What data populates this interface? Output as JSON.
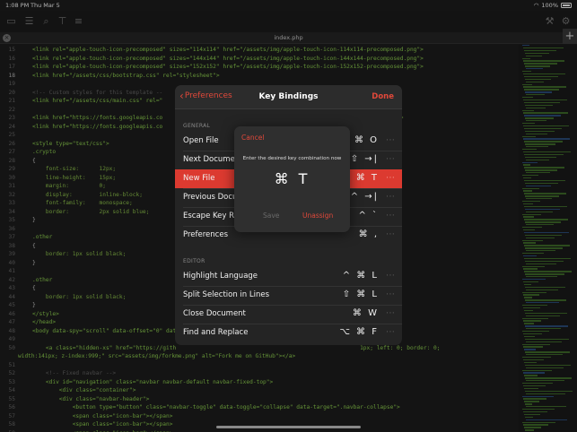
{
  "status_bar": {
    "time": "1:08 PM",
    "date": "Thu Mar 5",
    "battery": "100%"
  },
  "tab": {
    "title": "index.php",
    "add_label": "+"
  },
  "editor": {
    "lines": [
      {
        "n": "15",
        "text": "<link rel=\"apple-touch-icon-precomposed\" sizes=\"114x114\" href=\"/assets/img/apple-touch-icon-114x114-precomposed.png\">",
        "kind": "tag"
      },
      {
        "n": "16",
        "text": "<link rel=\"apple-touch-icon-precomposed\" sizes=\"144x144\" href=\"/assets/img/apple-touch-icon-144x144-precomposed.png\">",
        "kind": "tag"
      },
      {
        "n": "17",
        "text": "<link rel=\"apple-touch-icon-precomposed\" sizes=\"152x152\" href=\"/assets/img/apple-touch-icon-152x152-precomposed.png\">",
        "kind": "tag"
      },
      {
        "n": "18",
        "text": "<link href=\"/assets/css/bootstrap.css\" rel=\"stylesheet\">",
        "kind": "tag",
        "current": true
      },
      {
        "n": "19",
        "text": "",
        "kind": "tag"
      },
      {
        "n": "20",
        "text": "<!-- Custom styles for this template --",
        "kind": "comment"
      },
      {
        "n": "21",
        "text": "<link href=\"/assets/css/main.css\" rel=\"",
        "kind": "tag"
      },
      {
        "n": "22",
        "text": "",
        "kind": "tag"
      },
      {
        "n": "23",
        "text": "<link href=\"https://fonts.googleapis.co                                                     t' type='text/css'>",
        "kind": "tag"
      },
      {
        "n": "24",
        "text": "<link href=\"https://fonts.googleapis.co                                                     ss'>",
        "kind": "tag"
      },
      {
        "n": "25",
        "text": "",
        "kind": "tag"
      },
      {
        "n": "26",
        "text": "<style type=\"text/css\">",
        "kind": "tag"
      },
      {
        "n": "27",
        "text": ".crypto",
        "kind": "tag"
      },
      {
        "n": "28",
        "text": "{",
        "kind": "plain"
      },
      {
        "n": "29",
        "text": "    font-size:      12px;",
        "kind": "prop"
      },
      {
        "n": "30",
        "text": "    line-height:    15px;",
        "kind": "prop"
      },
      {
        "n": "31",
        "text": "    margin:         0;",
        "kind": "prop"
      },
      {
        "n": "32",
        "text": "    display:        inline-block;",
        "kind": "prop"
      },
      {
        "n": "33",
        "text": "    font-family:    monospace;",
        "kind": "prop"
      },
      {
        "n": "34",
        "text": "    border:         2px solid blue;",
        "kind": "prop"
      },
      {
        "n": "35",
        "text": "}",
        "kind": "plain"
      },
      {
        "n": "36",
        "text": "",
        "kind": "plain"
      },
      {
        "n": "37",
        "text": ".other",
        "kind": "tag"
      },
      {
        "n": "38",
        "text": "{",
        "kind": "plain"
      },
      {
        "n": "39",
        "text": "    border: 1px solid black;",
        "kind": "prop"
      },
      {
        "n": "40",
        "text": "}",
        "kind": "plain"
      },
      {
        "n": "41",
        "text": "",
        "kind": "plain"
      },
      {
        "n": "42",
        "text": ".other",
        "kind": "tag"
      },
      {
        "n": "43",
        "text": "{",
        "kind": "plain"
      },
      {
        "n": "44",
        "text": "    border: 1px solid black;",
        "kind": "prop"
      },
      {
        "n": "45",
        "text": "}",
        "kind": "plain"
      },
      {
        "n": "46",
        "text": "</style>",
        "kind": "tag"
      },
      {
        "n": "47",
        "text": "</head>",
        "kind": "tag"
      },
      {
        "n": "48",
        "text": "<body data-spy=\"scroll\" data-offset=\"0\" dat",
        "kind": "tag"
      },
      {
        "n": "49",
        "text": "",
        "kind": "plain"
      },
      {
        "n": "50",
        "text": "    <a class=\"hidden-xs\" href=\"https://gith                                                       1px; left: 0; border: 0;",
        "kind": "tag"
      },
      {
        "n": "",
        "text": "width:141px; z-index:999;\" src=\"assets/img/forkme.png\" alt=\"Fork me on GitHub\"></a>",
        "kind": "tag",
        "wrap": true
      },
      {
        "n": "51",
        "text": "",
        "kind": "plain"
      },
      {
        "n": "52",
        "text": "    <!-- Fixed navbar -->",
        "kind": "comment"
      },
      {
        "n": "53",
        "text": "    <div id=\"navigation\" class=\"navbar navbar-default navbar-fixed-top\">",
        "kind": "tag"
      },
      {
        "n": "54",
        "text": "        <div class=\"container\">",
        "kind": "tag"
      },
      {
        "n": "55",
        "text": "        <div class=\"navbar-header\">",
        "kind": "tag"
      },
      {
        "n": "56",
        "text": "            <button type=\"button\" class=\"navbar-toggle\" data-toggle=\"collapse\" data-target=\".navbar-collapse\">",
        "kind": "tag"
      },
      {
        "n": "57",
        "text": "            <span class=\"icon-bar\"></span>",
        "kind": "tag"
      },
      {
        "n": "58",
        "text": "            <span class=\"icon-bar\"></span>",
        "kind": "tag"
      },
      {
        "n": "59",
        "text": "            <span class=\"icon-bar\"></span>",
        "kind": "tag"
      }
    ]
  },
  "key_bindings": {
    "back_label": "Preferences",
    "title": "Key Bindings",
    "done_label": "Done",
    "general_label": "GENERAL",
    "editor_label": "EDITOR",
    "more_glyph": "⋯",
    "general": [
      {
        "name": "Open File",
        "keys": "⌘ O"
      },
      {
        "name": "Next Document",
        "keys": "⇧ →|"
      },
      {
        "name": "New File",
        "keys": "⌘ T",
        "selected": true
      },
      {
        "name": "Previous Docum",
        "keys": "^ →|"
      },
      {
        "name": "Escape Key Rep",
        "keys": "^ `"
      },
      {
        "name": "Preferences",
        "keys": "⌘ ,"
      }
    ],
    "editor": [
      {
        "name": "Highlight Language",
        "keys": "^ ⌘ L"
      },
      {
        "name": "Split Selection in Lines",
        "keys": "⇧ ⌘ L"
      },
      {
        "name": "Close Document",
        "keys": "⌘ W"
      },
      {
        "name": "Find and Replace",
        "keys": "⌥ ⌘ F"
      }
    ]
  },
  "alert": {
    "cancel_label": "Cancel",
    "message": "Enter the desired key combination now",
    "combo": "⌘ T",
    "save_label": "Save",
    "unassign_label": "Unassign"
  },
  "colors": {
    "accent": "#dc3a30",
    "code_green": "#8fd14f",
    "code_blue": "#3b9bd6"
  }
}
